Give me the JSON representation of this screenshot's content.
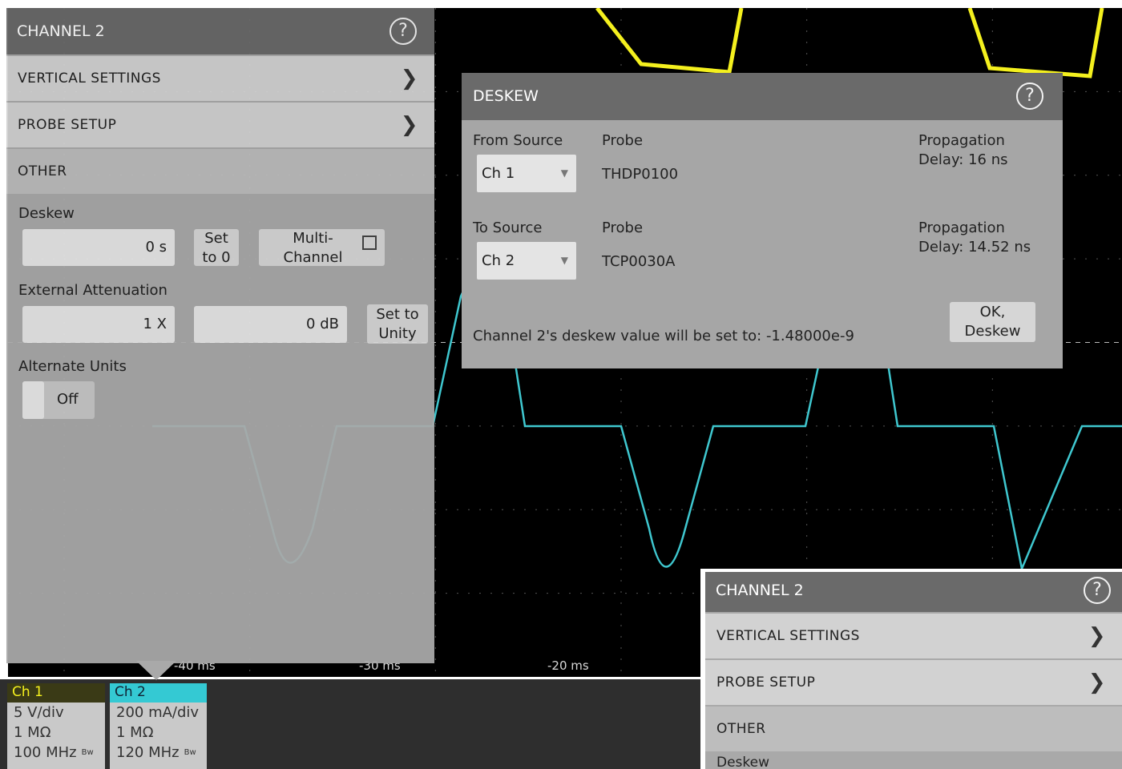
{
  "graticule": {
    "time_labels": [
      "-40 ms",
      "-30 ms",
      "-20 ms"
    ]
  },
  "waveforms": [
    {
      "name": "Ch 1",
      "color": "#f4f01e"
    },
    {
      "name": "Ch 2",
      "color": "#3fc7cf"
    }
  ],
  "channel_panel": {
    "title": "CHANNEL 2",
    "menu": [
      "VERTICAL SETTINGS",
      "PROBE SETUP",
      "OTHER"
    ],
    "deskew_label": "Deskew",
    "deskew_value": "0 s",
    "set_to_zero_label": [
      "Set",
      "to 0"
    ],
    "multichannel_label": [
      "Multi-",
      "Channel"
    ],
    "external_attenuation_label": "External Attenuation",
    "attenuation_value": "1 X",
    "attenuation_db": "0 dB",
    "set_to_unity_label": [
      "Set to",
      "Unity"
    ],
    "alternate_units_label": "Alternate Units",
    "alternate_units_state": "Off"
  },
  "deskew_dialog": {
    "title": "DESKEW",
    "from_source_label": "From Source",
    "from_source_value": "Ch 1",
    "from_probe_label": "Probe",
    "from_probe_value": "THDP0100",
    "from_delay_label": "Propagation",
    "from_delay_value": "Delay: 16 ns",
    "to_source_label": "To Source",
    "to_source_value": "Ch 2",
    "to_probe_label": "Probe",
    "to_probe_value": "TCP0030A",
    "to_delay_label": "Propagation",
    "to_delay_value": "Delay: 14.52 ns",
    "message": "Channel 2's deskew value will be set to: -1.48000e-9",
    "ok_label": [
      "OK,",
      "Deskew"
    ]
  },
  "channel_badges": [
    {
      "name": "Ch 1",
      "scale": "5 V/div",
      "impedance": "1 MΩ",
      "bandwidth": "100 MHz",
      "bw_mark": "Bw",
      "head_color": "#3a3a16",
      "head_text_color": "#f4f01e"
    },
    {
      "name": "Ch 2",
      "scale": "200 mA/div",
      "impedance": "1 MΩ",
      "bandwidth": "120 MHz",
      "bw_mark": "Bw",
      "head_color": "#34c9d3",
      "head_text_color": "#123"
    }
  ],
  "channel_panel_2": {
    "title": "CHANNEL 2",
    "menu": [
      "VERTICAL SETTINGS",
      "PROBE SETUP",
      "OTHER",
      "Deskew"
    ]
  }
}
